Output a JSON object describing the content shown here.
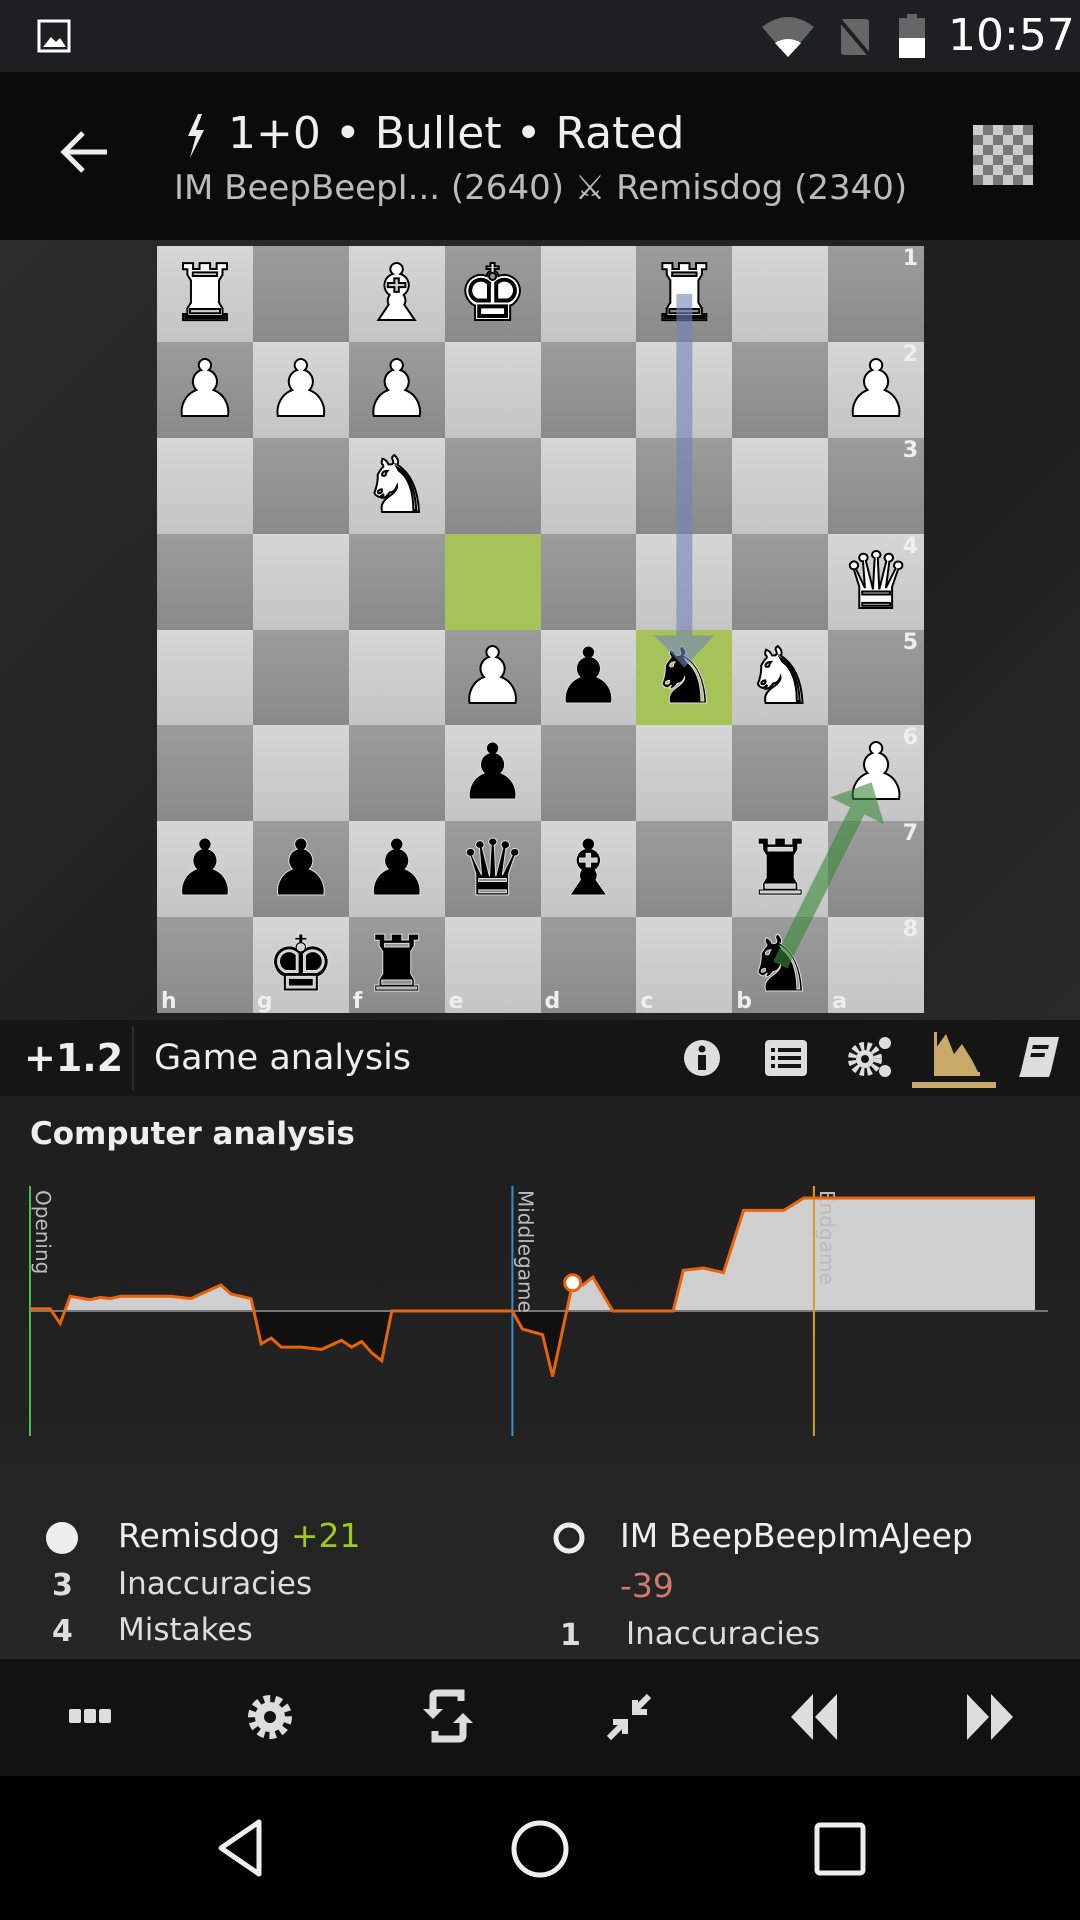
{
  "status_bar": {
    "time": "10:57",
    "icons": [
      "image-icon",
      "wifi-icon",
      "no-sim-icon",
      "battery-icon"
    ]
  },
  "header": {
    "title": "1+0 • Bullet • Rated",
    "players": "IM BeepBeepI... (2640) ⚔ Remisdog (2340)",
    "icons": [
      "back-arrow-icon",
      "bolt-icon",
      "board-icon"
    ]
  },
  "board": {
    "orientation": "black",
    "files": [
      "h",
      "g",
      "f",
      "e",
      "d",
      "c",
      "b",
      "a"
    ],
    "ranks": [
      "1",
      "2",
      "3",
      "4",
      "5",
      "6",
      "7",
      "8"
    ],
    "rows": [
      [
        "R",
        "",
        "B",
        "K",
        "",
        "R",
        "",
        ""
      ],
      [
        "P",
        "P",
        "P",
        "",
        "",
        "",
        "",
        "P"
      ],
      [
        "",
        "",
        "N",
        "",
        "",
        "",
        "",
        ""
      ],
      [
        "",
        "",
        "",
        "",
        "",
        "",
        "",
        "Q"
      ],
      [
        "",
        "",
        "",
        "P",
        "p",
        "n",
        "N",
        ""
      ],
      [
        "",
        "",
        "",
        "p",
        "",
        "",
        "",
        "P"
      ],
      [
        "p",
        "p",
        "p",
        "q",
        "b",
        "",
        "r",
        ""
      ],
      [
        "",
        "k",
        "r",
        "",
        "",
        "",
        "n",
        ""
      ]
    ],
    "last_move": [
      "e4",
      "c5"
    ],
    "arrows": [
      {
        "from": "c1",
        "to": "c5",
        "color": "#6f86b8"
      },
      {
        "from": "b8",
        "to": "a6",
        "color": "#3a8a3a"
      }
    ],
    "highlight_color": "#a8c25a"
  },
  "analysis_bar": {
    "eval": "+1.2",
    "title": "Game analysis",
    "tabs": [
      "info-icon",
      "move-list-icon",
      "engine-settings-icon",
      "chart-icon",
      "book-icon"
    ],
    "active_tab": 3,
    "accent": "#c8a96a"
  },
  "section_title": "Computer analysis",
  "chart_data": {
    "type": "area",
    "x": [
      0,
      2,
      3,
      4,
      6,
      7,
      8,
      9,
      14,
      16,
      17,
      19,
      20,
      22,
      23,
      24,
      25,
      27,
      29,
      31,
      32,
      33,
      34,
      35,
      36,
      48,
      49,
      51,
      52,
      54,
      55,
      56,
      58,
      64,
      65,
      67,
      69,
      71,
      75,
      77,
      100
    ],
    "y": [
      0.02,
      0.02,
      -0.11,
      0.13,
      0.1,
      0.12,
      0.11,
      0.13,
      0.13,
      0.11,
      0.15,
      0.23,
      0.15,
      0.11,
      -0.29,
      -0.24,
      -0.32,
      -0.32,
      -0.34,
      -0.26,
      -0.32,
      -0.27,
      -0.37,
      -0.44,
      0,
      0,
      -0.16,
      -0.21,
      -0.58,
      0.25,
      0.23,
      0.3,
      0,
      0,
      0.36,
      0.38,
      0.34,
      0.89,
      0.89,
      1.0,
      1.0
    ],
    "ylim": [
      -1,
      1
    ],
    "xlim": [
      0,
      100
    ],
    "current_x": 54,
    "phases": [
      {
        "label": "Opening",
        "x": 0,
        "color": "#3ec24a"
      },
      {
        "label": "Middlegame",
        "x": 48,
        "color": "#3a8fc8"
      },
      {
        "label": "Endgame",
        "x": 78,
        "color": "#d89a2a"
      }
    ],
    "line_color": "#e8630a",
    "fill_above": "#cfcfcf",
    "fill_below": "#111111"
  },
  "summary": {
    "white": {
      "name": "Remisdog",
      "score": "+21",
      "score_color": "#9ccc1a",
      "rows": [
        {
          "count": "3",
          "label": "Inaccuracies"
        },
        {
          "count": "4",
          "label": "Mistakes"
        }
      ]
    },
    "black": {
      "name": "IM BeepBeepImAJeep",
      "score": "-39",
      "score_color": "#d07a72",
      "rows": [
        {
          "count": "1",
          "label": "Inaccuracies"
        }
      ]
    }
  },
  "toolbar": [
    "more-icon",
    "settings-icon",
    "flip-board-icon",
    "collapse-icon",
    "rewind-icon",
    "forward-icon"
  ],
  "nav": [
    "back-nav-icon",
    "home-nav-icon",
    "recents-nav-icon"
  ]
}
